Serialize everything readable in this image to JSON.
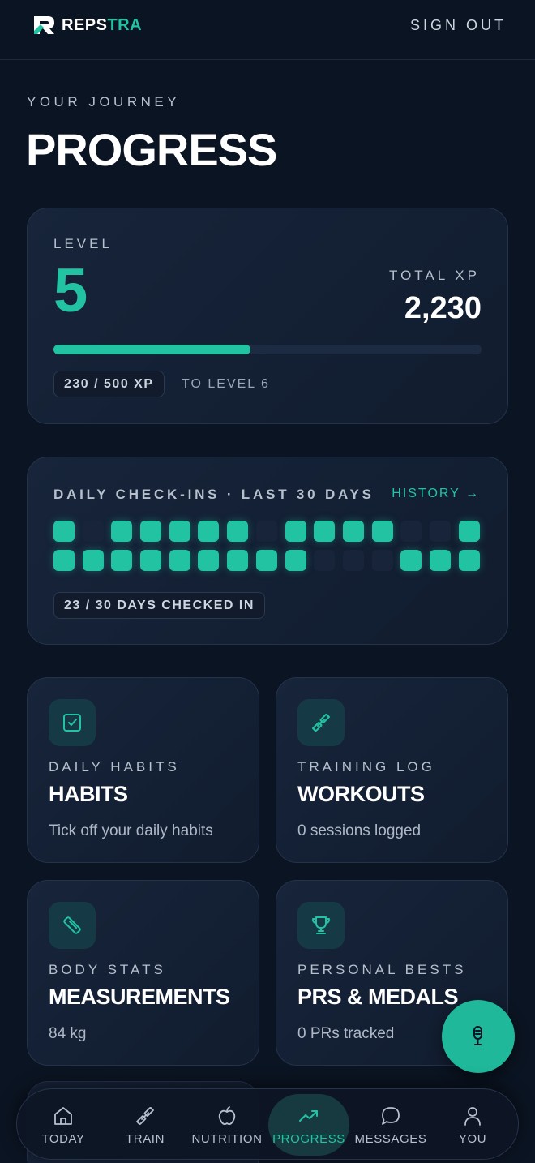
{
  "header": {
    "brand_part1": "REPS",
    "brand_part2": "TRA",
    "signout_label": "SIGN OUT"
  },
  "page": {
    "eyebrow": "YOUR JOURNEY",
    "title": "PROGRESS"
  },
  "level_card": {
    "level_label": "LEVEL",
    "level_value": "5",
    "xp_label": "TOTAL XP",
    "xp_value": "2,230",
    "progress_fraction": 0.46,
    "xp_progress": "230 / 500 XP",
    "to_next": "TO LEVEL 6"
  },
  "checkins": {
    "title": "DAILY CHECK-INS · LAST 30 DAYS",
    "history_label": "HISTORY →",
    "days": [
      1,
      0,
      1,
      1,
      1,
      1,
      1,
      0,
      1,
      1,
      1,
      1,
      0,
      0,
      1,
      1,
      1,
      1,
      1,
      1,
      1,
      1,
      1,
      1,
      0,
      0,
      0,
      1,
      1,
      1
    ],
    "summary": "23 / 30 DAYS CHECKED IN"
  },
  "tiles": [
    {
      "icon": "checkbox-icon",
      "eyebrow": "DAILY HABITS",
      "title": "HABITS",
      "sub": "Tick off your daily habits"
    },
    {
      "icon": "dumbbell-icon",
      "eyebrow": "TRAINING LOG",
      "title": "WORKOUTS",
      "sub": "0 sessions logged"
    },
    {
      "icon": "ruler-icon",
      "eyebrow": "BODY STATS",
      "title": "MEASUREMENTS",
      "sub": "84 kg"
    },
    {
      "icon": "trophy-icon",
      "eyebrow": "PERSONAL BESTS",
      "title": "PRS & MEDALS",
      "sub": "0 PRs tracked"
    }
  ],
  "fab": {
    "icon": "microphone-icon"
  },
  "nav": [
    {
      "label": "TODAY",
      "icon": "home-icon",
      "active": false
    },
    {
      "label": "TRAIN",
      "icon": "dumbbell-icon",
      "active": false
    },
    {
      "label": "NUTRITION",
      "icon": "apple-icon",
      "active": false
    },
    {
      "label": "PROGRESS",
      "icon": "trend-up-icon",
      "active": true
    },
    {
      "label": "MESSAGES",
      "icon": "chat-bubble-icon",
      "active": false
    },
    {
      "label": "YOU",
      "icon": "user-icon",
      "active": false
    }
  ],
  "colors": {
    "accent": "#22c3a3",
    "background": "#0b1422",
    "card": "#151f33"
  }
}
